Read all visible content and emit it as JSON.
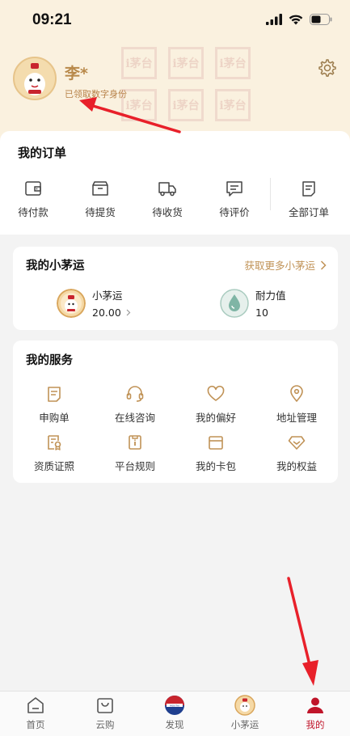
{
  "status_bar": {
    "time": "09:21"
  },
  "profile": {
    "name": "李*",
    "status": "已领取数字身份",
    "watermark_text": "i茅台"
  },
  "orders": {
    "title": "我的订单",
    "items": [
      {
        "label": "待付款",
        "icon": "wallet-icon"
      },
      {
        "label": "待提货",
        "icon": "package-icon"
      },
      {
        "label": "待收货",
        "icon": "truck-icon"
      },
      {
        "label": "待评价",
        "icon": "review-icon"
      },
      {
        "label": "全部订单",
        "icon": "order-list-icon"
      }
    ]
  },
  "luck": {
    "title": "我的小茅运",
    "more_label": "获取更多小茅运",
    "stats": [
      {
        "name": "小茅运",
        "value": "20.00",
        "icon": "xiaomao-coin-icon"
      },
      {
        "name": "耐力值",
        "value": "10",
        "icon": "water-drop-icon"
      }
    ]
  },
  "services": {
    "title": "我的服务",
    "items": [
      {
        "label": "申购单",
        "icon": "form-icon"
      },
      {
        "label": "在线咨询",
        "icon": "headset-icon"
      },
      {
        "label": "我的偏好",
        "icon": "heart-icon"
      },
      {
        "label": "地址管理",
        "icon": "location-icon"
      },
      {
        "label": "资质证照",
        "icon": "certificate-icon"
      },
      {
        "label": "平台规则",
        "icon": "rules-icon"
      },
      {
        "label": "我的卡包",
        "icon": "card-icon"
      },
      {
        "label": "我的权益",
        "icon": "benefits-icon"
      }
    ]
  },
  "tabbar": {
    "items": [
      {
        "label": "首页",
        "icon": "home-icon"
      },
      {
        "label": "云购",
        "icon": "shopping-bag-icon"
      },
      {
        "label": "发现",
        "icon": "discover-logo-icon"
      },
      {
        "label": "小茅运",
        "icon": "xiaomao-icon"
      },
      {
        "label": "我的",
        "icon": "user-icon"
      }
    ],
    "active_index": 4
  },
  "colors": {
    "accent_gold": "#c09256",
    "header_bg": "#faf1df",
    "active_red": "#c0152a",
    "arrow_red": "#e8202a"
  }
}
